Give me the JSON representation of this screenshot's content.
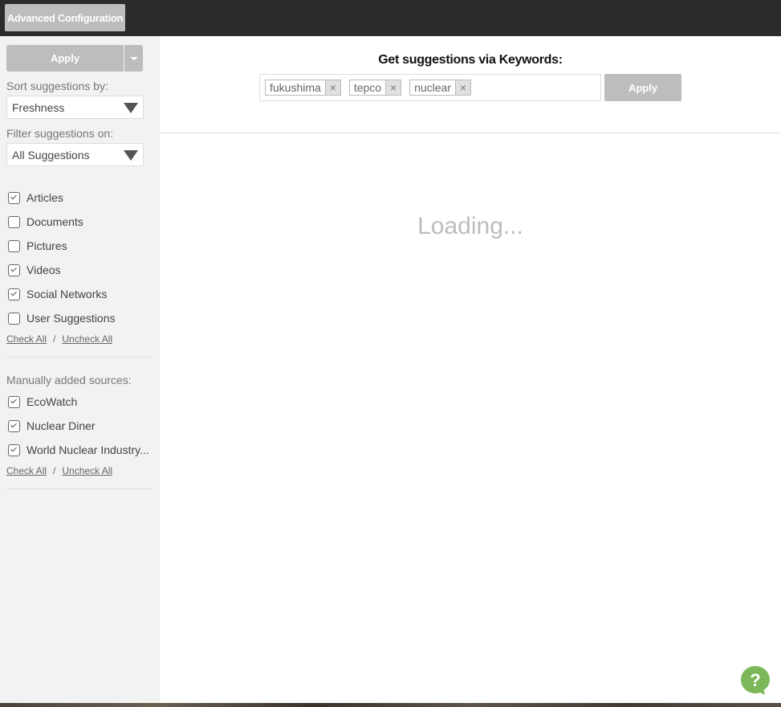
{
  "topbar": {
    "advanced_config_label": "Advanced Configuration"
  },
  "sidebar": {
    "apply_label": "Apply",
    "sort_label": "Sort suggestions by:",
    "sort_value": "Freshness",
    "filter_label": "Filter suggestions on:",
    "filter_value": "All Suggestions",
    "types": [
      {
        "label": "Articles",
        "checked": true
      },
      {
        "label": "Documents",
        "checked": false
      },
      {
        "label": "Pictures",
        "checked": false
      },
      {
        "label": "Videos",
        "checked": true
      },
      {
        "label": "Social Networks",
        "checked": true
      },
      {
        "label": "User Suggestions",
        "checked": false
      }
    ],
    "check_all": "Check All",
    "separator": "/",
    "uncheck_all": "Uncheck All",
    "manual_label": "Manually added sources:",
    "sources": [
      {
        "label": "EcoWatch",
        "checked": true
      },
      {
        "label": "Nuclear Diner",
        "checked": true
      },
      {
        "label": "World Nuclear Industry...",
        "checked": true
      }
    ]
  },
  "main": {
    "keywords_title": "Get suggestions via Keywords:",
    "keywords": [
      "fukushima",
      "tepco",
      "nuclear"
    ],
    "remove_glyph": "×",
    "apply_label": "Apply",
    "loading_text": "Loading..."
  },
  "colors": {
    "help_green": "#7cb85a",
    "button_gray": "#bdbdbd",
    "topbar": "#2d2b2a"
  }
}
